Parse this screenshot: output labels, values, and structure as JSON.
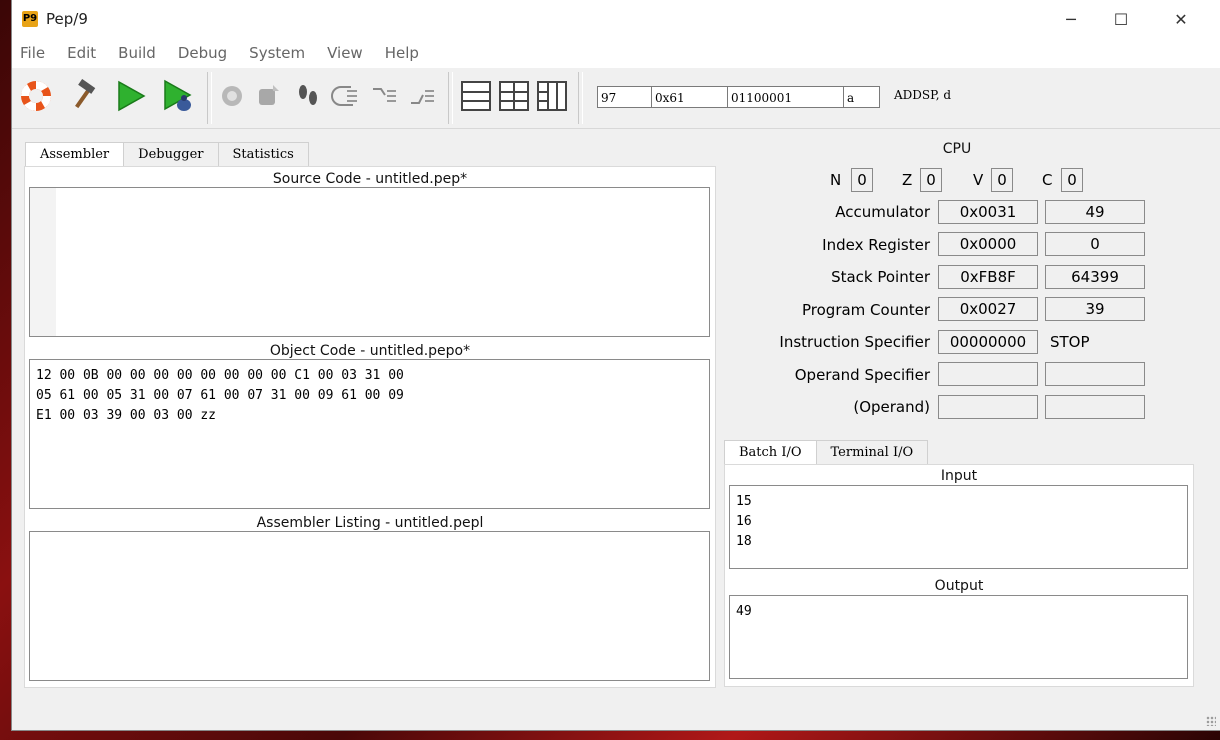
{
  "window": {
    "app_icon": "P9",
    "title": "Pep/9",
    "minimize": "─",
    "maximize": "☐",
    "close": "✕"
  },
  "menu": [
    "File",
    "Edit",
    "Build",
    "Debug",
    "System",
    "View",
    "Help"
  ],
  "toolbar": {
    "icons": [
      "help-lifebuoy-icon",
      "build-hammer-icon",
      "run-play-icon",
      "debug-bug-icon",
      "start-icon",
      "interrupt-icon",
      "step-icon",
      "step-over-icon",
      "step-into-icon",
      "step-out-icon",
      "layout-single-icon",
      "layout-split-icon",
      "layout-three-icon"
    ],
    "decimal": "97",
    "hex": "0x61",
    "binary": "01100001",
    "ascii": "a",
    "instruction": "ADDSP, d"
  },
  "left_tabs": [
    "Assembler",
    "Debugger",
    "Statistics"
  ],
  "source": {
    "title": "Source Code - untitled.pep*",
    "lines": []
  },
  "object": {
    "title": "Object Code - untitled.pepo*",
    "lines": [
      "12 00 0B 00 00 00 00 00 00 00 00 C1 00 03 31 00",
      "05 61 00 05 31 00 07 61 00 07 31 00 09 61 00 09",
      "E1 00 03 39 00 03 00 zz"
    ]
  },
  "listing": {
    "title": "Assembler Listing - untitled.pepl"
  },
  "cpu": {
    "title": "CPU",
    "flags": [
      {
        "name": "N",
        "value": "0"
      },
      {
        "name": "Z",
        "value": "0"
      },
      {
        "name": "V",
        "value": "0"
      },
      {
        "name": "C",
        "value": "0"
      }
    ],
    "registers": [
      {
        "label": "Accumulator",
        "hex": "0x0031",
        "dec": "49"
      },
      {
        "label": "Index Register",
        "hex": "0x0000",
        "dec": "0"
      },
      {
        "label": "Stack Pointer",
        "hex": "0xFB8F",
        "dec": "64399"
      },
      {
        "label": "Program Counter",
        "hex": "0x0027",
        "dec": "39"
      },
      {
        "label": "Instruction Specifier",
        "hex": "00000000",
        "dec": "STOP"
      },
      {
        "label": "Operand Specifier",
        "hex": "",
        "dec": ""
      },
      {
        "label": "(Operand)",
        "hex": "",
        "dec": ""
      }
    ]
  },
  "io_tabs": [
    "Batch I/O",
    "Terminal I/O"
  ],
  "io": {
    "input_title": "Input",
    "input_lines": [
      "15",
      "16",
      "18"
    ],
    "output_title": "Output",
    "output_lines": [
      "49"
    ]
  }
}
